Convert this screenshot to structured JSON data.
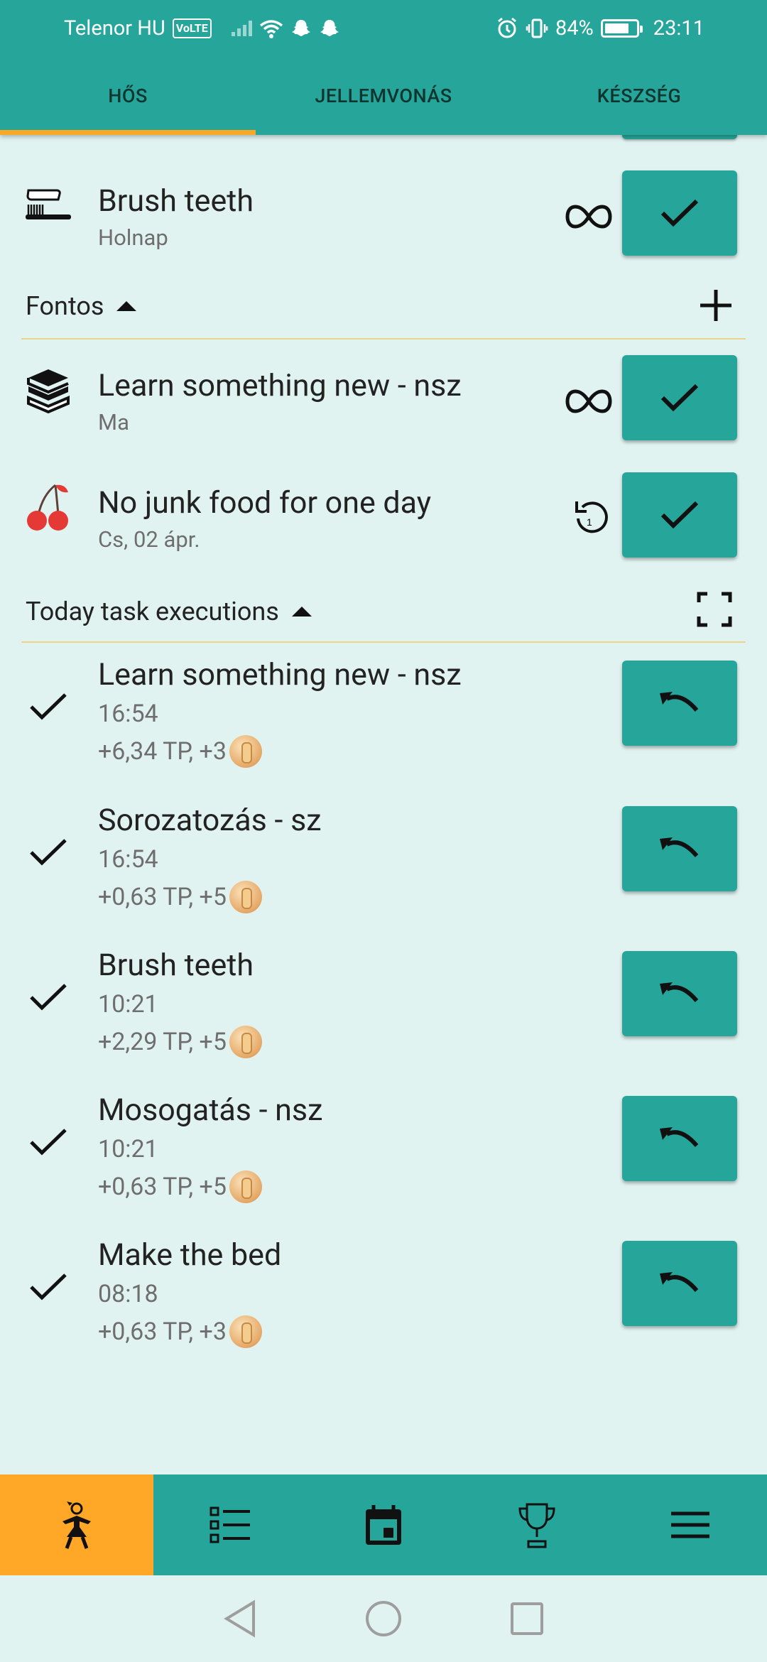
{
  "status": {
    "carrier": "Telenor HU",
    "volte": "VoLTE",
    "battery": "84%",
    "time": "23:11"
  },
  "tabs": [
    "HŐS",
    "JELLEMVONÁS",
    "KÉSZSÉG"
  ],
  "tasks_top": [
    {
      "title": "Brush teeth",
      "date": "Holnap",
      "icon": "toothbrush-icon",
      "mode": "infinity-icon"
    }
  ],
  "fontos": {
    "title": "Fontos",
    "tasks": [
      {
        "title": "Learn something new - nsz",
        "date": "Ma",
        "icon": "books-icon",
        "mode": "infinity-icon"
      },
      {
        "title": "No junk food for one day",
        "date": "Cs, 02 ápr.",
        "icon": "cherry-icon",
        "mode": "repeat-once-icon"
      }
    ]
  },
  "executions": {
    "title": "Today task executions",
    "items": [
      {
        "title": "Learn something new - nsz",
        "time": "16:54",
        "reward": "+6,34 TP, +3"
      },
      {
        "title": "Sorozatozás - sz",
        "time": "16:54",
        "reward": "+0,63 TP, +5"
      },
      {
        "title": "Brush teeth",
        "time": "10:21",
        "reward": "+2,29 TP, +5"
      },
      {
        "title": "Mosogatás - nsz",
        "time": "10:21",
        "reward": "+0,63 TP, +5"
      },
      {
        "title": "Make the bed",
        "time": "08:18",
        "reward": "+0,63 TP, +3"
      }
    ]
  },
  "bottom_nav": [
    "hero-icon",
    "task-list-icon",
    "calendar-icon",
    "trophy-icon",
    "menu-icon"
  ],
  "colors": {
    "primary": "#26a69a",
    "accent": "#ffa726",
    "background": "#e1f3f1",
    "divider": "#ecd38c"
  }
}
